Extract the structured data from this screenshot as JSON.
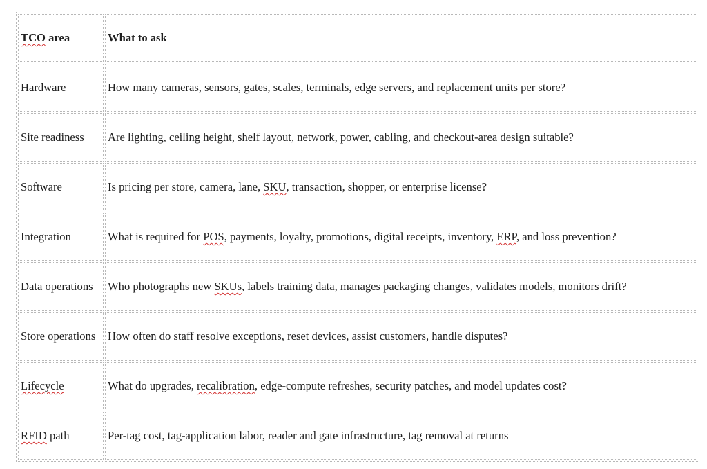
{
  "table": {
    "header": {
      "area_prefix": "TCO",
      "area_suffix": " area",
      "question": "What to ask"
    },
    "rows": [
      {
        "area": {
          "a": "Hardware",
          "b": "",
          "c": ""
        },
        "question": {
          "a": "How many cameras, sensors, gates, scales, terminals, edge servers, and replacement units per store?",
          "b": "",
          "c": "",
          "d": "",
          "e": ""
        }
      },
      {
        "area": {
          "a": "Site readiness",
          "b": "",
          "c": ""
        },
        "question": {
          "a": "Are lighting, ceiling height, shelf layout, network, power, cabling, and checkout-area design suitable?",
          "b": "",
          "c": "",
          "d": "",
          "e": ""
        }
      },
      {
        "area": {
          "a": "Software",
          "b": "",
          "c": ""
        },
        "question": {
          "a": "Is pricing per store, camera, lane, ",
          "b": "SKU",
          "c": ", transaction, shopper, or enterprise license?",
          "d": "",
          "e": ""
        }
      },
      {
        "area": {
          "a": "Integration",
          "b": "",
          "c": ""
        },
        "question": {
          "a": "What is required for ",
          "b": "POS",
          "c": ", payments, loyalty, promotions, digital receipts, inventory, ",
          "d": "ERP",
          "e": ", and loss prevention?"
        }
      },
      {
        "area": {
          "a": "Data operations",
          "b": "",
          "c": ""
        },
        "question": {
          "a": "Who photographs new ",
          "b": "SKUs",
          "c": ", labels training data, manages packaging changes, validates models, monitors drift?",
          "d": "",
          "e": ""
        }
      },
      {
        "area": {
          "a": "Store operations",
          "b": "",
          "c": ""
        },
        "question": {
          "a": "How often do staff resolve exceptions, reset devices, assist customers, handle disputes?",
          "b": "",
          "c": "",
          "d": "",
          "e": ""
        }
      },
      {
        "area": {
          "a": "",
          "b": "Lifecycle",
          "c": ""
        },
        "question": {
          "a": "What do upgrades, ",
          "b": "recalibration",
          "c": ", edge-compute refreshes, security patches, and model updates cost?",
          "d": "",
          "e": ""
        }
      },
      {
        "area": {
          "a": "",
          "b": "RFID",
          "c": " path"
        },
        "question": {
          "a": "Per-tag cost, tag-application labor, reader and gate infrastructure, tag removal at returns",
          "b": "",
          "c": "",
          "d": "",
          "e": ""
        }
      }
    ]
  }
}
